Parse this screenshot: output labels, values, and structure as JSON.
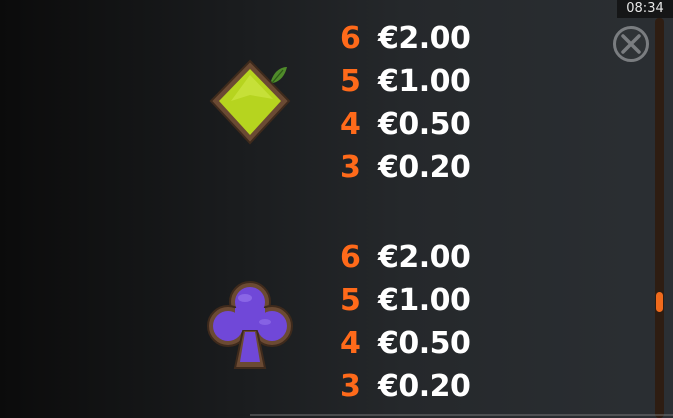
{
  "status": {
    "time": "08:34"
  },
  "close_icon": "close-x-icon",
  "colors": {
    "count": "#ff6a1a",
    "amount": "#ffffff",
    "scroll_thumb": "#f06a1c",
    "diamond_fill": "#b6d41f",
    "club_fill": "#7048d8",
    "wood": "#6b4a33"
  },
  "scroll": {
    "position_fraction": 0.71
  },
  "paytable": [
    {
      "symbol": "green-diamond-icon",
      "rows": [
        {
          "count": "6",
          "amount": "€2.00"
        },
        {
          "count": "5",
          "amount": "€1.00"
        },
        {
          "count": "4",
          "amount": "€0.50"
        },
        {
          "count": "3",
          "amount": "€0.20"
        }
      ]
    },
    {
      "symbol": "purple-club-icon",
      "rows": [
        {
          "count": "6",
          "amount": "€2.00"
        },
        {
          "count": "5",
          "amount": "€1.00"
        },
        {
          "count": "4",
          "amount": "€0.50"
        },
        {
          "count": "3",
          "amount": "€0.20"
        }
      ]
    }
  ]
}
